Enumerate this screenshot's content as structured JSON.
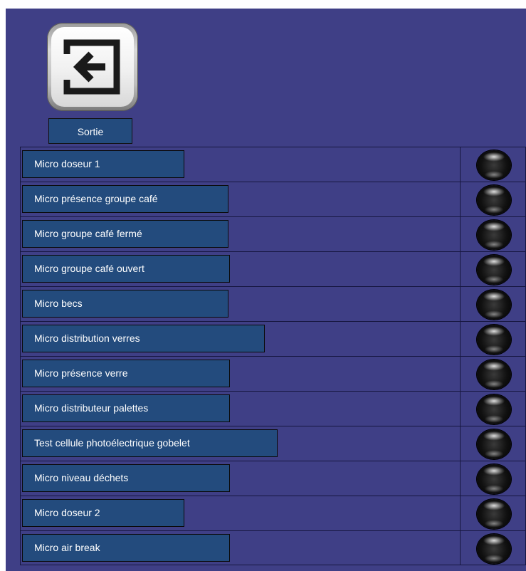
{
  "exit": {
    "label": "Sortie",
    "icon": "exit-arrow-icon"
  },
  "rows": [
    {
      "label": "Micro doseur 1",
      "indicator": "off"
    },
    {
      "label": "Micro présence groupe café",
      "indicator": "off"
    },
    {
      "label": "Micro groupe café fermé",
      "indicator": "off"
    },
    {
      "label": "Micro groupe café ouvert",
      "indicator": "off"
    },
    {
      "label": "Micro becs",
      "indicator": "off"
    },
    {
      "label": "Micro distribution verres",
      "indicator": "off"
    },
    {
      "label": "Micro présence verre",
      "indicator": "off"
    },
    {
      "label": "Micro distributeur palettes",
      "indicator": "off"
    },
    {
      "label": "Test cellule photoélectrique gobelet",
      "indicator": "off"
    },
    {
      "label": "Micro niveau déchets",
      "indicator": "off"
    },
    {
      "label": "Micro doseur 2",
      "indicator": "off"
    },
    {
      "label": "Micro air break",
      "indicator": "off"
    }
  ],
  "colors": {
    "panel": "#3f3f86",
    "label_bg": "#234b7d",
    "indicator_off": "#111111"
  }
}
